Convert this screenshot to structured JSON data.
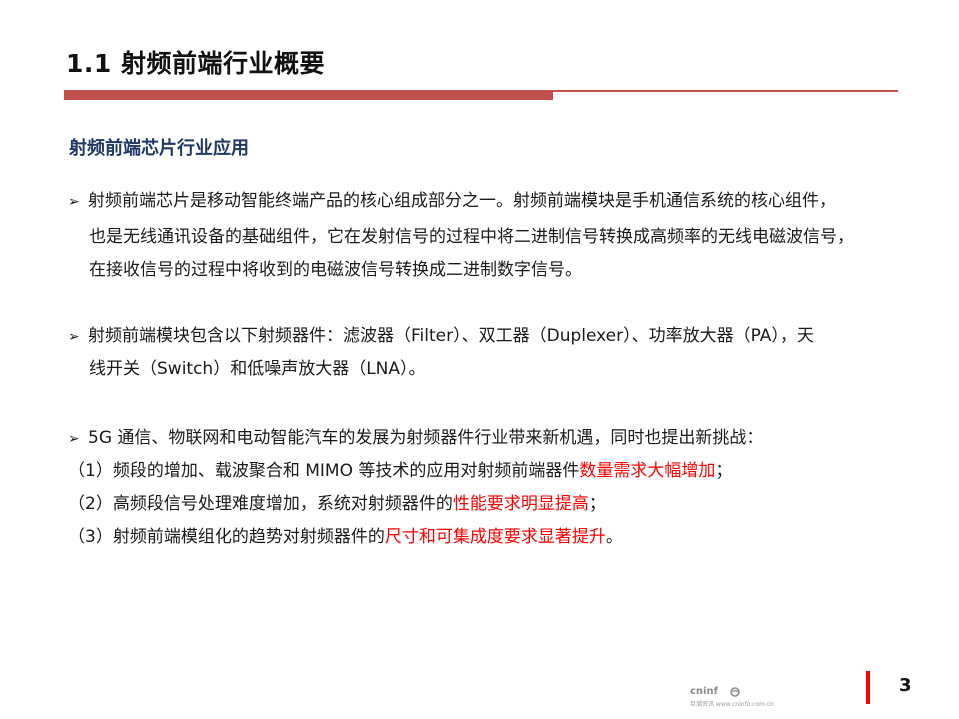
{
  "title": "1.1 射频前端行业概要",
  "subtitle": "射频前端芯片行业应用",
  "bullet_icon": "arrow-bullet-icon",
  "para1": {
    "line1": "射频前端芯片是移动智能终端产品的核心组成部分之一。射频前端模块是手机通信系统的核心组件，",
    "line2": "也是无线通讯设备的基础组件，它在发射信号的过程中将二进制信号转换成高频率的无线电磁波信号，",
    "line3": "在接收信号的过程中将收到的电磁波信号转换成二进制数字信号。"
  },
  "para2": {
    "line1": "射频前端模块包含以下射频器件：滤波器（Filter）、双工器（Duplexer）、功率放大器（PA），天",
    "line2": "线开关（Switch）和低噪声放大器（LNA）。"
  },
  "para3": {
    "line1": "5G 通信、物联网和电动智能汽车的发展为射频器件行业带来新机遇，同时也提出新挑战：",
    "item1_prefix": "（1）频段的增加、载波聚合和 MIMO 等技术的应用对射频前端器件",
    "item1_highlight": "数量需求大幅增加",
    "item1_suffix": "；",
    "item2_prefix": "（2）高频段信号处理难度增加，系统对射频器件的",
    "item2_highlight": "性能要求明显提高",
    "item2_suffix": "；",
    "item3_prefix": "（3）射频前端模组化的趋势对射频器件的",
    "item3_highlight": "尺寸和可集成度要求显著提升",
    "item3_suffix": "。"
  },
  "page_number": "3",
  "logo": {
    "word": "cninf",
    "sub": "巨潮资讯 www.cninfo.com.cn"
  },
  "colors": {
    "accent_rule": "#c0504d",
    "subtitle": "#1f3864",
    "highlight": "#ff0000",
    "page_bar": "#ff0000"
  }
}
